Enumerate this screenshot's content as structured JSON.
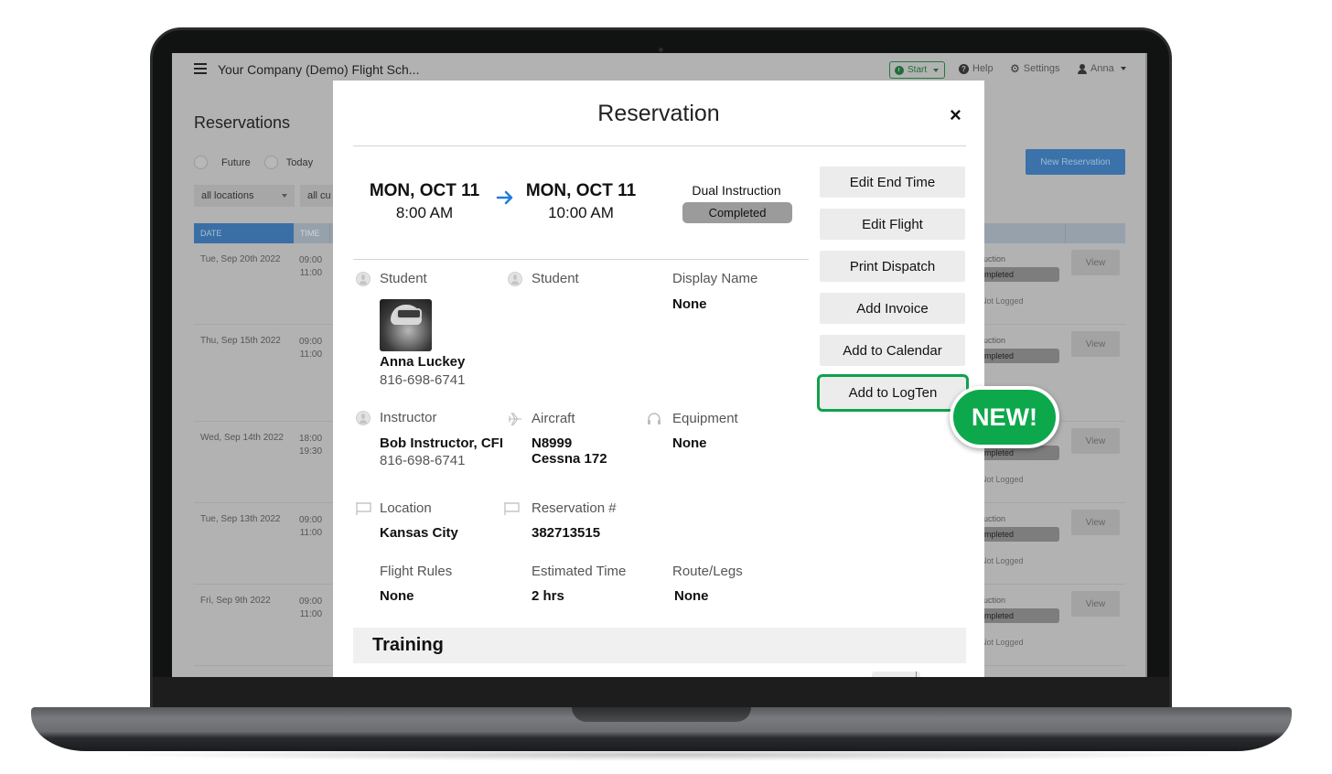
{
  "app": {
    "title": "Your Company (Demo) Flight Sch...",
    "start_label": "Start",
    "help_label": "Help",
    "settings_label": "Settings",
    "user_label": "Anna"
  },
  "page": {
    "title": "Reservations",
    "filters": {
      "radios": [
        "Future",
        "Today"
      ],
      "location_select": "all locations",
      "customer_select": "all cu"
    },
    "new_reservation_label": "New Reservation",
    "table": {
      "headers": [
        "DATE",
        "TIME"
      ],
      "rows": [
        {
          "date": "Tue, Sep 20th 2022",
          "start": "09:00",
          "end": "11:00",
          "type": "ruction",
          "status": "mpleted",
          "logged": "Not Logged",
          "view": "View"
        },
        {
          "date": "Thu, Sep 15th 2022",
          "start": "09:00",
          "end": "11:00",
          "type": "ruction",
          "status": "mpleted",
          "logged": "",
          "view": "View"
        },
        {
          "date": "Wed, Sep 14th 2022",
          "start": "18:00",
          "end": "19:30",
          "type": "",
          "status": "mpleted",
          "logged": "Not Logged",
          "view": "View"
        },
        {
          "date": "Tue, Sep 13th 2022",
          "start": "09:00",
          "end": "11:00",
          "type": "ruction",
          "status": "mpleted",
          "logged": "Not Logged",
          "view": "View"
        },
        {
          "date": "Fri, Sep 9th 2022",
          "start": "09:00",
          "end": "11:00",
          "type": "ruction",
          "status": "mpleted",
          "logged": "Not Logged",
          "view": "View"
        }
      ]
    }
  },
  "modal": {
    "title": "Reservation",
    "start": {
      "date": "MON, OCT 11",
      "time": "8:00 AM"
    },
    "end": {
      "date": "MON, OCT 11",
      "time": "10:00 AM"
    },
    "type": "Dual Instruction",
    "status": "Completed",
    "actions": [
      "Edit End Time",
      "Edit Flight",
      "Print Dispatch",
      "Add Invoice",
      "Add to Calendar",
      "Add to LogTen"
    ],
    "new_badge": "NEW!",
    "fields": {
      "student1": {
        "label": "Student",
        "name": "Anna Luckey",
        "phone": "816-698-6741"
      },
      "student2": {
        "label": "Student"
      },
      "display_name": {
        "label": "Display Name",
        "value": "None"
      },
      "instructor": {
        "label": "Instructor",
        "name": "Bob Instructor, CFI",
        "phone": "816-698-6741"
      },
      "aircraft": {
        "label": "Aircraft",
        "tail": "N8999",
        "model": "Cessna 172"
      },
      "equipment": {
        "label": "Equipment",
        "value": "None"
      },
      "location": {
        "label": "Location",
        "value": "Kansas City"
      },
      "reservation_no": {
        "label": "Reservation #",
        "value": "382713515"
      },
      "flight_rules": {
        "label": "Flight Rules",
        "value": "None"
      },
      "estimated_time": {
        "label": "Estimated Time",
        "value": "2 hrs"
      },
      "route_legs": {
        "label": "Route/Legs",
        "value": "None"
      }
    },
    "training_title": "Training"
  },
  "colors": {
    "accent_green": "#0ea84c",
    "primary_blue": "#3a72a9",
    "arrow_blue": "#1e7fd6"
  }
}
